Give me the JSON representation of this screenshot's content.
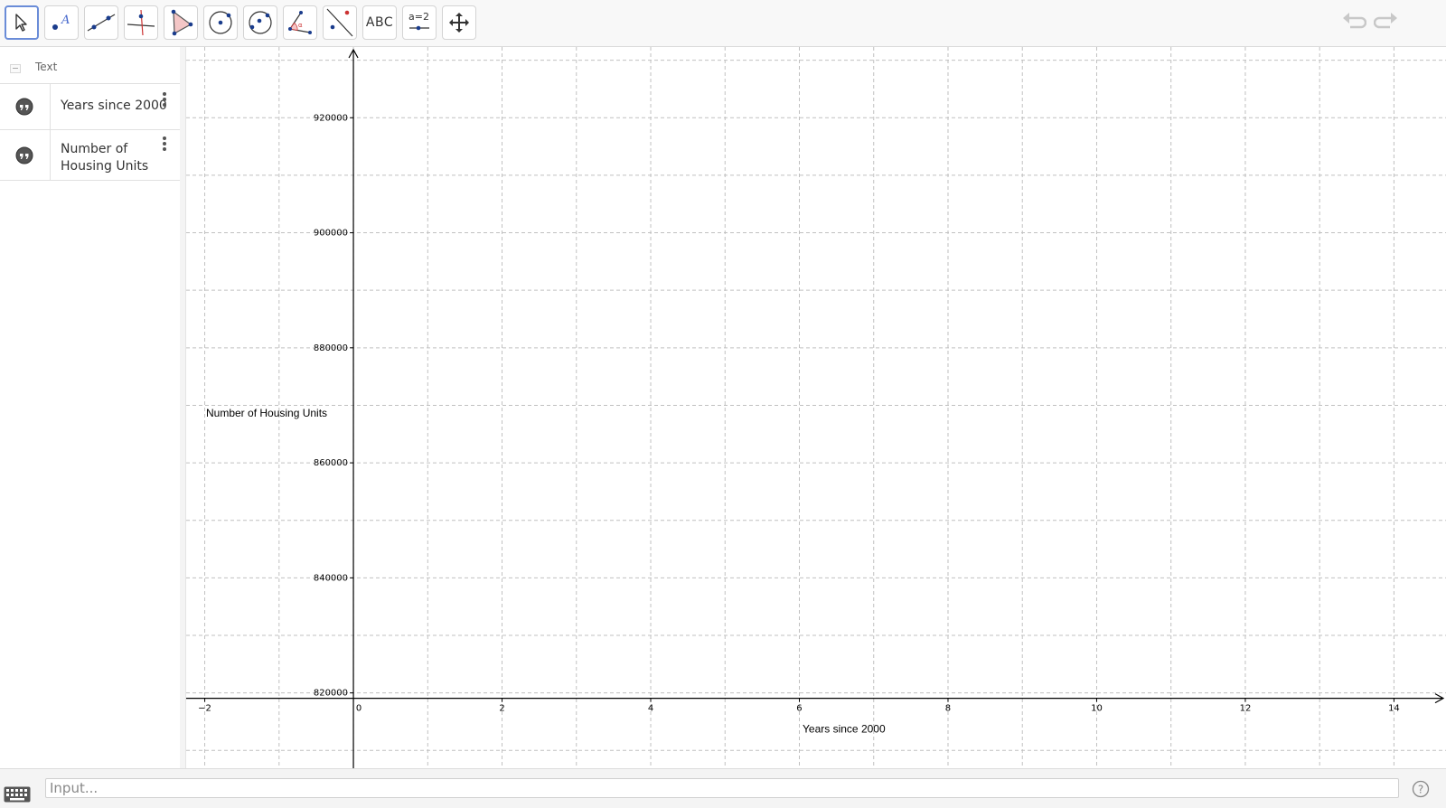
{
  "toolbar": {
    "tools": [
      {
        "name": "move-tool",
        "label": ""
      },
      {
        "name": "point-tool",
        "label": ""
      },
      {
        "name": "line-tool",
        "label": ""
      },
      {
        "name": "perpendicular-line-tool",
        "label": ""
      },
      {
        "name": "polygon-tool",
        "label": ""
      },
      {
        "name": "circle-center-point-tool",
        "label": ""
      },
      {
        "name": "circle-three-points-tool",
        "label": ""
      },
      {
        "name": "angle-tool",
        "label": ""
      },
      {
        "name": "reflect-tool",
        "label": ""
      },
      {
        "name": "text-tool",
        "label": "ABC"
      },
      {
        "name": "slider-tool",
        "label": "a=2"
      },
      {
        "name": "move-graphics-view-tool",
        "label": ""
      }
    ],
    "undo_icon": "undo-icon",
    "redo_icon": "redo-icon"
  },
  "algebra": {
    "section_label": "Text",
    "items": [
      {
        "text": "Years since 2000"
      },
      {
        "text": "Number of Housing Units"
      }
    ]
  },
  "chart_data": {
    "type": "scatter",
    "title": "",
    "xlabel": "Years since 2000",
    "ylabel": "Number of Housing Units",
    "xlim": [
      -2.25,
      14.7
    ],
    "ylim": [
      806900,
      932300
    ],
    "x_ticks": [
      -2,
      0,
      2,
      4,
      6,
      8,
      10,
      12,
      14
    ],
    "x_tick_labels": [
      "−2",
      "0",
      "2",
      "4",
      "6",
      "8",
      "10",
      "12",
      "14"
    ],
    "y_ticks": [
      820000,
      840000,
      860000,
      880000,
      900000,
      920000
    ],
    "y_tick_labels": [
      "820000",
      "840000",
      "860000",
      "880000",
      "900000",
      "920000"
    ],
    "grid": true,
    "series": []
  },
  "input": {
    "placeholder": "Input..."
  }
}
